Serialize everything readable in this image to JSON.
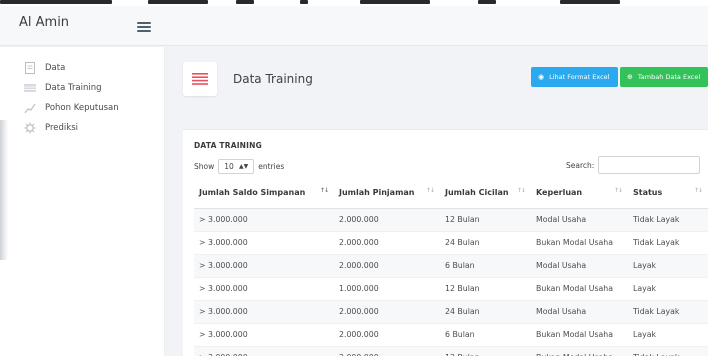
{
  "app": {
    "brand": "Al Amin"
  },
  "sidebar": {
    "items": [
      {
        "label": "Data",
        "icon": "file-icon"
      },
      {
        "label": "Data Training",
        "icon": "table-icon"
      },
      {
        "label": "Pohon Keputusan",
        "icon": "chart-line-icon"
      },
      {
        "label": "Prediksi",
        "icon": "gear-icon"
      }
    ]
  },
  "page": {
    "title": "Data Training",
    "buttons": {
      "view_excel": "Lihat Format Excel",
      "add_excel": "Tambah Data Excel"
    },
    "colors": {
      "blue": "#2aa9ee",
      "green": "#33c15a",
      "accent_red": "#e8505b"
    }
  },
  "panel": {
    "title": "DATA TRAINING",
    "show_label": "Show",
    "entries_value": "10",
    "entries_label": "entries",
    "search_label": "Search:",
    "search_value": ""
  },
  "table": {
    "headers": [
      "Jumlah Saldo Simpanan",
      "Jumlah Pinjaman",
      "Jumlah Cicilan",
      "Keperluan",
      "Status"
    ],
    "rows": [
      [
        "> 3.000.000",
        "2.000.000",
        "12 Bulan",
        "Modal Usaha",
        "Tidak Layak"
      ],
      [
        "> 3.000.000",
        "2.000.000",
        "24 Bulan",
        "Bukan Modal Usaha",
        "Tidak Layak"
      ],
      [
        "> 3.000.000",
        "2.000.000",
        "6 Bulan",
        "Modal Usaha",
        "Layak"
      ],
      [
        "> 3.000.000",
        "1.000.000",
        "12 Bulan",
        "Bukan Modal Usaha",
        "Layak"
      ],
      [
        "> 3.000.000",
        "2.000.000",
        "24 Bulan",
        "Modal Usaha",
        "Tidak Layak"
      ],
      [
        "> 3.000.000",
        "2.000.000",
        "6 Bulan",
        "Bukan Modal Usaha",
        "Layak"
      ],
      [
        "> 3.000.000",
        "2.000.000",
        "12 Bulan",
        "Bukan Modal Usaha",
        "Tidak Layak"
      ]
    ]
  }
}
